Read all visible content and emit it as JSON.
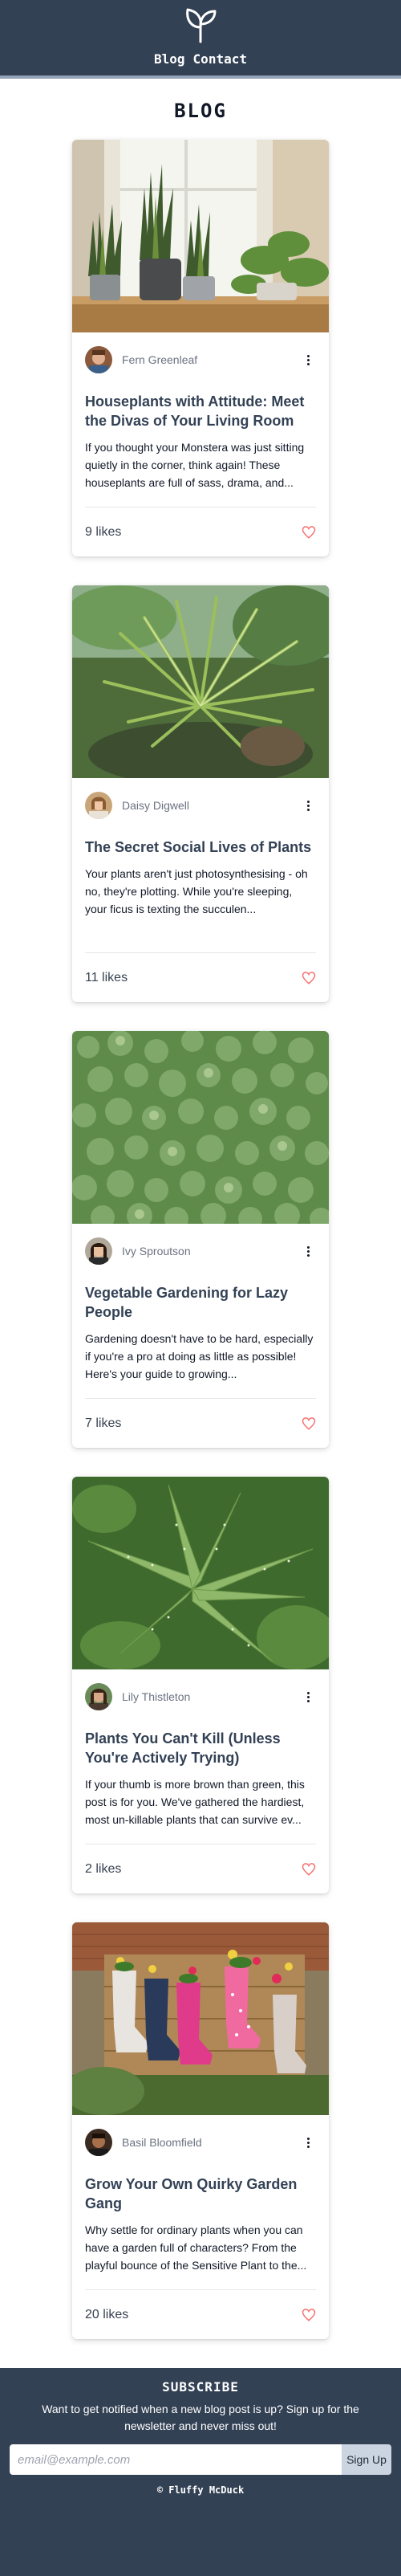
{
  "header": {
    "logo_icon": "sprout-icon",
    "nav": [
      {
        "label": "Blog"
      },
      {
        "label": "Contact"
      }
    ]
  },
  "page_title": "BLOG",
  "posts": [
    {
      "author": "Fern Greenleaf",
      "title": "Houseplants with Attitude: Meet the Divas of Your Living Room",
      "excerpt": "If you thought your Monstera was just sitting quietly in the corner, think again! These houseplants are full of sass, drama, and...",
      "likes": "9 likes",
      "image": "potted-snake-plants-on-windowsill"
    },
    {
      "author": "Daisy Digwell",
      "title": "The Secret Social Lives of Plants",
      "excerpt": "Your plants aren't just photosynthesising - oh no, they're plotting. While you're sleeping, your ficus is texting the succulen...",
      "likes": "11 likes",
      "image": "spiky-palm-in-garden"
    },
    {
      "author": "Ivy Sprouts​on",
      "title": "Vegetable Gardening for Lazy People",
      "excerpt": "Gardening doesn't have to be hard, especially if you're a pro at doing as little as possible! Here's your guide to growing...",
      "likes": "7 likes",
      "image": "leafy-vegetable-field"
    },
    {
      "author": "Lily Thistleton",
      "title": "Plants You Can't Kill (Unless You're Actively Trying)",
      "excerpt": "If your thumb is more brown than green, this post is for you. We've gathered the hardiest, most un-killable plants that can survive ev...",
      "likes": "2 likes",
      "image": "aloe-plant-closeup"
    },
    {
      "author": "Basil Bloomfield",
      "title": "Grow Your Own Quirky Garden Gang",
      "excerpt": "Why settle for ordinary plants when you can have a garden full of characters? From the playful bounce of the Sensitive Plant to the...",
      "likes": "20 likes",
      "image": "rain-boot-planters-on-crate"
    }
  ],
  "subscribe": {
    "title": "SUBSCRIBE",
    "text": "Want to get notified when a new blog post is up? Sign up for the newsletter and never miss out!",
    "placeholder": "email@example.com",
    "button": "Sign Up"
  },
  "footer": {
    "copyright": "© Fluffy McDuck"
  },
  "colors": {
    "header_bg": "#334155",
    "heart": "#f87171",
    "title": "#334155"
  }
}
